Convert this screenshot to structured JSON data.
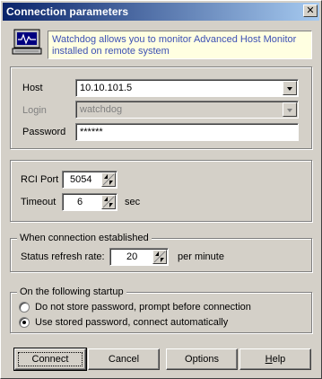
{
  "window": {
    "title": "Connection parameters",
    "close_glyph": "✕",
    "info_icon": "monitor-pulse-icon",
    "info_text": "Watchdog allows you to monitor Advanced Host Monitor installed on remote system"
  },
  "connection": {
    "host_label": "Host",
    "host_value": "10.10.101.5",
    "login_label": "Login",
    "login_value": "watchdog",
    "password_label": "Password",
    "password_value": "******"
  },
  "rci": {
    "port_label": "RCI Port",
    "port_value": "5054",
    "timeout_label": "Timeout",
    "timeout_value": "6",
    "timeout_unit": "sec"
  },
  "established": {
    "group_title": "When connection established",
    "refresh_label": "Status refresh rate:",
    "refresh_value": "20",
    "refresh_unit": "per minute"
  },
  "startup": {
    "group_title": "On the following startup",
    "options": [
      {
        "label": "Do not store password, prompt before connection",
        "selected": false
      },
      {
        "label": "Use stored password, connect automatically",
        "selected": true
      }
    ]
  },
  "buttons": {
    "connect": "Connect",
    "cancel": "Cancel",
    "options": "Options",
    "help_first": "H",
    "help_rest": "elp"
  },
  "colors": {
    "title_gradient_start": "#0a246a",
    "title_gradient_end": "#a6caf0",
    "info_background": "#ffffe1",
    "info_text": "#3c50b4",
    "dialog_face": "#d4d0c8"
  }
}
